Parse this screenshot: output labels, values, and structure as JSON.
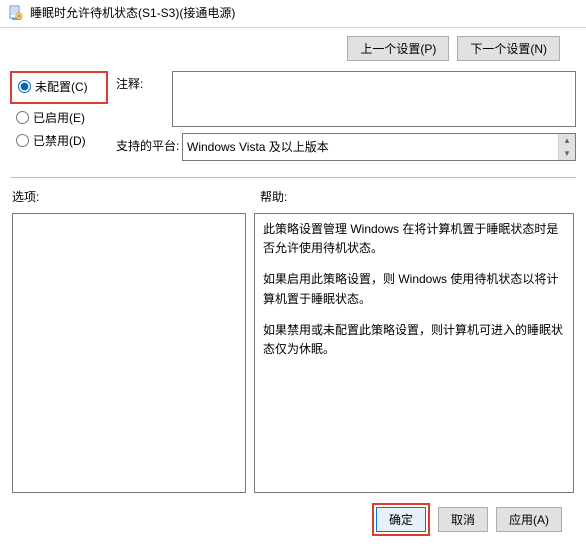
{
  "title": "睡眠时允许待机状态(S1-S3)(接通电源)",
  "nav": {
    "prev": "上一个设置(P)",
    "next": "下一个设置(N)"
  },
  "radios": {
    "not_configured": "未配置(C)",
    "enabled": "已启用(E)",
    "disabled": "已禁用(D)"
  },
  "comment": {
    "label": "注释:",
    "value": ""
  },
  "platform": {
    "label": "支持的平台:",
    "value": "Windows Vista 及以上版本"
  },
  "sections": {
    "options": "选项:",
    "help": "帮助:"
  },
  "help": {
    "p1": "此策略设置管理 Windows 在将计算机置于睡眠状态时是否允许使用待机状态。",
    "p2": "如果启用此策略设置，则 Windows 使用待机状态以将计算机置于睡眠状态。",
    "p3": "如果禁用或未配置此策略设置，则计算机可进入的睡眠状态仅为休眠。"
  },
  "footer": {
    "ok": "确定",
    "cancel": "取消",
    "apply": "应用(A)"
  }
}
